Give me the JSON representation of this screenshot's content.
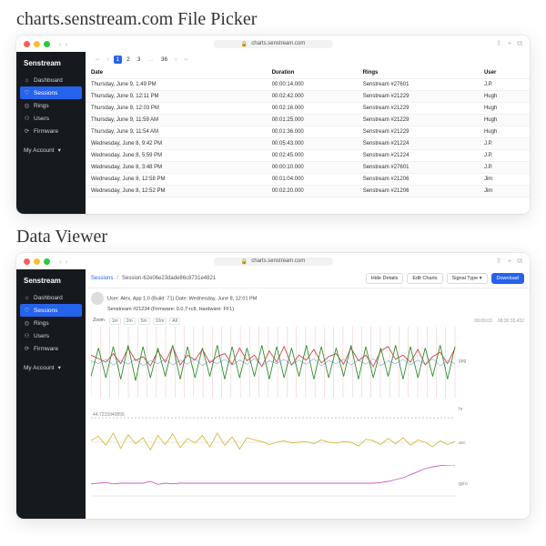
{
  "caption1": "charts.senstream.com File Picker",
  "caption2": "Data Viewer",
  "url": "charts.senstream.com",
  "brand": "Senstream",
  "sidebar": {
    "items": [
      {
        "icon": "⌂",
        "label": "Dashboard"
      },
      {
        "icon": "♡",
        "label": "Sessions"
      },
      {
        "icon": "◎",
        "label": "Rings"
      },
      {
        "icon": "⚇",
        "label": "Users"
      },
      {
        "icon": "⟳",
        "label": "Firmware"
      }
    ],
    "account": "My Account",
    "chevron": "▾"
  },
  "pager": {
    "pages": [
      "‹‹",
      "‹",
      "1",
      "2",
      "3",
      "…",
      "36",
      "›",
      "››"
    ],
    "currentIndex": 2
  },
  "table": {
    "headers": [
      "Date",
      "Duration",
      "Rings",
      "User"
    ],
    "rows": [
      [
        "Thursday, June 9, 1:49 PM",
        "00:00:14.000",
        "Senstream #27601",
        "J.P."
      ],
      [
        "Thursday, June 9, 12:11 PM",
        "00:02:42.000",
        "Senstream #21229",
        "Hugh"
      ],
      [
        "Thursday, June 9, 12:03 PM",
        "00:02:16.000",
        "Senstream #21229",
        "Hugh"
      ],
      [
        "Thursday, June 9, 11:59 AM",
        "00:01:25.000",
        "Senstream #21229",
        "Hugh"
      ],
      [
        "Thursday, June 9, 11:54 AM",
        "00:01:36.000",
        "Senstream #21229",
        "Hugh"
      ],
      [
        "Wednesday, June 8, 9:42 PM",
        "00:05:43.000",
        "Senstream #21224",
        "J.P."
      ],
      [
        "Wednesday, June 8, 5:59 PM",
        "00:02:45.000",
        "Senstream #21224",
        "J.P."
      ],
      [
        "Wednesday, June 8, 3:48 PM",
        "00:00:10.000",
        "Senstream #27601",
        "J.P."
      ],
      [
        "Wednesday, June 8, 12:58 PM",
        "00:01:04.000",
        "Senstream #21206",
        "Jim"
      ],
      [
        "Wednesday, June 8, 12:52 PM",
        "00:02:20.000",
        "Senstream #21206",
        "Jim"
      ]
    ]
  },
  "viewer": {
    "breadcrumb": {
      "root": "Sessions",
      "id": "Session-62e06e23dade86c8731e4821"
    },
    "buttons": {
      "hide": "Hide Details",
      "edit": "Edit Charts",
      "signal": "Signal Type",
      "download": "Download"
    },
    "meta": {
      "line1": "User: Alex, App 1.0 (Build: 71) Date: Wednesday, June 8, 12:01 PM",
      "line2": "Senstream #21234 (Firmware: 0.0.7-rc8, Hardware: FF1)"
    },
    "zoom": [
      "Zoom",
      "1m",
      "2m",
      "5m",
      "10m",
      "All"
    ],
    "timestamps": [
      "08:09:03",
      "08:30:33.432"
    ]
  },
  "chart_data": [
    {
      "type": "line",
      "title": "",
      "ylabel": "ppg",
      "xlim": [
        0,
        100
      ],
      "ylim": [
        0,
        100
      ],
      "series": [
        {
          "name": "red",
          "color": "#d24a4a",
          "values": [
            60,
            55,
            50,
            62,
            48,
            70,
            52,
            58,
            45,
            66,
            50,
            72,
            46,
            60,
            53,
            68,
            49,
            58,
            62,
            47,
            70,
            52,
            60,
            44,
            66,
            50,
            72,
            46,
            60,
            53,
            68,
            49,
            58,
            62,
            47,
            70,
            52,
            60,
            44,
            66,
            72,
            54,
            60,
            50,
            68,
            46,
            58,
            64,
            48,
            70
          ]
        },
        {
          "name": "green",
          "color": "#2f8f2f",
          "values": [
            30,
            70,
            28,
            72,
            26,
            74,
            24,
            72,
            28,
            70,
            30,
            74,
            26,
            72,
            28,
            70,
            30,
            74,
            26,
            72,
            28,
            70,
            30,
            74,
            26,
            72,
            28,
            70,
            30,
            74,
            26,
            72,
            28,
            70,
            30,
            74,
            26,
            72,
            28,
            70,
            30,
            74,
            26,
            72,
            28,
            70,
            30,
            74,
            26,
            72
          ]
        },
        {
          "name": "blue",
          "color": "#4a7ad2",
          "values": [
            52,
            48,
            54,
            46,
            53,
            47,
            55,
            45,
            52,
            48,
            54,
            46,
            53,
            47,
            55,
            45,
            52,
            48,
            54,
            46,
            53,
            47,
            55,
            45,
            52,
            48,
            54,
            46,
            53,
            47,
            55,
            45,
            52,
            48,
            54,
            46,
            53,
            47,
            55,
            45,
            52,
            48,
            54,
            46,
            53,
            47,
            55,
            45,
            52,
            48
          ]
        }
      ]
    },
    {
      "type": "line",
      "title": "",
      "ylabel": "hr",
      "xlim": [
        0,
        100
      ],
      "ylim": [
        40,
        100
      ],
      "annotation": "44.7215940856",
      "series": [
        {
          "name": "hr",
          "color": "#888",
          "flat": 44.72
        }
      ]
    },
    {
      "type": "line",
      "title": "",
      "ylabel": "acc",
      "xlim": [
        0,
        100
      ],
      "ylim": [
        -3,
        3
      ],
      "series": [
        {
          "name": "yellow",
          "color": "#d8b93a",
          "values": [
            0.2,
            0.8,
            -0.4,
            1.2,
            -0.8,
            1.0,
            -0.2,
            0.6,
            -1.0,
            0.9,
            -0.3,
            1.1,
            -0.7,
            0.5,
            -0.1,
            0.9,
            -0.6,
            1.2,
            -0.4,
            0.7,
            -0.9,
            0.6,
            0.3,
            0.1,
            -0.3,
            0.0,
            0.2,
            -0.1,
            0.0,
            0.1,
            -0.2,
            0.3,
            0.0,
            -0.1,
            0.1,
            0.0,
            -0.5,
            0.4,
            0.2,
            -0.3,
            0.5,
            -0.2,
            0.6,
            -0.4,
            0.3,
            0.0,
            -0.6,
            0.2,
            -0.3,
            0.1
          ]
        }
      ]
    },
    {
      "type": "line",
      "title": "",
      "ylabel": "gyro",
      "xlim": [
        0,
        100
      ],
      "ylim": [
        -3,
        3
      ],
      "series": [
        {
          "name": "pink",
          "color": "#c85bc8",
          "values": [
            -0.1,
            0.0,
            0.1,
            -0.1,
            0.0,
            0.0,
            0.0,
            0.0,
            0.3,
            -0.2,
            0.0,
            -0.1,
            0.0,
            0.0,
            0.0,
            0.0,
            0.0,
            0.0,
            0.0,
            0.0,
            0.0,
            0.0,
            0.0,
            0.0,
            0.0,
            0.0,
            0.0,
            0.0,
            0.0,
            0.0,
            0.0,
            0.0,
            0.0,
            0.0,
            0.0,
            0.0,
            0.0,
            0.0,
            0.0,
            0.1,
            0.3,
            0.6,
            0.9,
            1.4,
            1.9,
            2.4,
            2.7,
            2.9,
            3.0,
            3.0
          ]
        }
      ]
    }
  ]
}
